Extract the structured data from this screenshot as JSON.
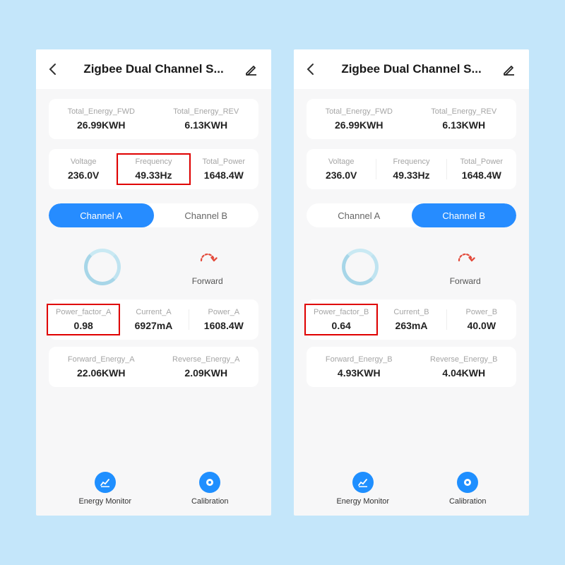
{
  "left": {
    "title": "Zigbee Dual Channel S...",
    "top": {
      "fwd_lbl": "Total_Energy_FWD",
      "fwd_val": "26.99KWH",
      "rev_lbl": "Total_Energy_REV",
      "rev_val": "6.13KWH"
    },
    "mains": {
      "v_lbl": "Voltage",
      "v_val": "236.0V",
      "f_lbl": "Frequency",
      "f_val": "49.33Hz",
      "p_lbl": "Total_Power",
      "p_val": "1648.4W"
    },
    "tabs": {
      "a": "Channel A",
      "b": "Channel B",
      "active": "a"
    },
    "forward_lbl": "Forward",
    "ch": {
      "pf_lbl": "Power_factor_A",
      "pf_val": "0.98",
      "i_lbl": "Current_A",
      "i_val": "6927mA",
      "w_lbl": "Power_A",
      "w_val": "1608.4W",
      "fe_lbl": "Forward_Energy_A",
      "fe_val": "22.06KWH",
      "re_lbl": "Reverse_Energy_A",
      "re_val": "2.09KWH"
    },
    "tools": {
      "monitor": "Energy Monitor",
      "calib": "Calibration"
    },
    "highlight_freq": true
  },
  "right": {
    "title": "Zigbee Dual Channel S...",
    "top": {
      "fwd_lbl": "Total_Energy_FWD",
      "fwd_val": "26.99KWH",
      "rev_lbl": "Total_Energy_REV",
      "rev_val": "6.13KWH"
    },
    "mains": {
      "v_lbl": "Voltage",
      "v_val": "236.0V",
      "f_lbl": "Frequency",
      "f_val": "49.33Hz",
      "p_lbl": "Total_Power",
      "p_val": "1648.4W"
    },
    "tabs": {
      "a": "Channel A",
      "b": "Channel B",
      "active": "b"
    },
    "forward_lbl": "Forward",
    "ch": {
      "pf_lbl": "Power_factor_B",
      "pf_val": "0.64",
      "i_lbl": "Current_B",
      "i_val": "263mA",
      "w_lbl": "Power_B",
      "w_val": "40.0W",
      "fe_lbl": "Forward_Energy_B",
      "fe_val": "4.93KWH",
      "re_lbl": "Reverse_Energy_B",
      "re_val": "4.04KWH"
    },
    "tools": {
      "monitor": "Energy Monitor",
      "calib": "Calibration"
    },
    "highlight_freq": false
  }
}
